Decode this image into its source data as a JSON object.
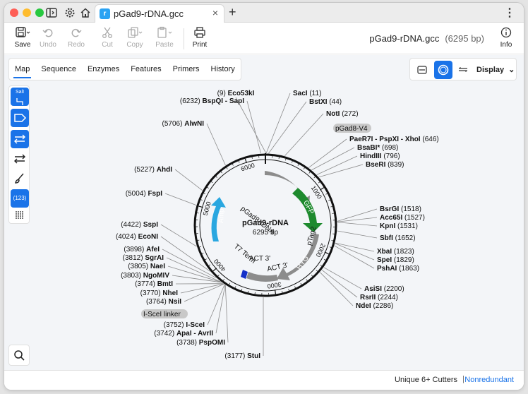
{
  "window": {
    "tab_title": "pGad9-rDNA.gcc",
    "tab_close": "×",
    "new_tab": "+",
    "menu": "⋮"
  },
  "toolbar": {
    "save": "Save",
    "undo": "Undo",
    "redo": "Redo",
    "cut": "Cut",
    "copy": "Copy",
    "paste": "Paste",
    "print": "Print",
    "info": "Info",
    "doc_name": "pGad9-rDNA.gcc",
    "doc_length": "(6295 bp)"
  },
  "view_tabs": [
    "Map",
    "Sequence",
    "Enzymes",
    "Features",
    "Primers",
    "History"
  ],
  "display": {
    "label": "Display"
  },
  "sidebar": {
    "sail_label": "SalI",
    "count_label": "(123)"
  },
  "map": {
    "name": "pGad9-rDNA",
    "length": "6295 bp",
    "ticks": [
      "1000",
      "2000",
      "3000",
      "4000",
      "5000",
      "6000"
    ],
    "features": {
      "pgad8_rdna": "pGad8-rDNA",
      "gfp": "GFP",
      "ptag2": "pTag2",
      "hyg": "HYG",
      "act3a": "ACT 3'",
      "act3b": "ACT 3'",
      "t7term": "T7 Term",
      "amp": "Amp"
    },
    "chips": {
      "pgad8_v4": "pGad8-V4",
      "isce_linker": "I-SceI linker"
    },
    "sites": [
      {
        "pos": "(9)",
        "name": "Eco53kI"
      },
      {
        "pos": "(11)",
        "name": "SacI",
        "pos_after": true
      },
      {
        "pos": "(44)",
        "name": "BstXI",
        "pos_after": true
      },
      {
        "pos": "(272)",
        "name": "NotI",
        "pos_after": true
      },
      {
        "pos": "(646)",
        "name": "PaeR7I - PspXI - XhoI",
        "pos_after": true
      },
      {
        "pos": "(698)",
        "name": "BsaBI*",
        "pos_after": true
      },
      {
        "pos": "(796)",
        "name": "HindIII",
        "pos_after": true
      },
      {
        "pos": "(839)",
        "name": "BseRI",
        "pos_after": true
      },
      {
        "pos": "(1518)",
        "name": "BsrGI",
        "pos_after": true
      },
      {
        "pos": "(1527)",
        "name": "Acc65I",
        "pos_after": true
      },
      {
        "pos": "(1531)",
        "name": "KpnI",
        "pos_after": true
      },
      {
        "pos": "(1652)",
        "name": "SbfI",
        "pos_after": true
      },
      {
        "pos": "(1823)",
        "name": "XbaI",
        "pos_after": true
      },
      {
        "pos": "(1829)",
        "name": "SpeI",
        "pos_after": true
      },
      {
        "pos": "(1863)",
        "name": "PshAI",
        "pos_after": true
      },
      {
        "pos": "(2200)",
        "name": "AsiSI",
        "pos_after": true
      },
      {
        "pos": "(2244)",
        "name": "RsrII",
        "pos_after": true
      },
      {
        "pos": "(2286)",
        "name": "NdeI",
        "pos_after": true
      },
      {
        "pos": "(3177)",
        "name": "StuI"
      },
      {
        "pos": "(3738)",
        "name": "PspOMI"
      },
      {
        "pos": "(3742)",
        "name": "ApaI - AvrII"
      },
      {
        "pos": "(3752)",
        "name": "I-SceI"
      },
      {
        "pos": "(3764)",
        "name": "NsiI"
      },
      {
        "pos": "(3770)",
        "name": "NheI"
      },
      {
        "pos": "(3774)",
        "name": "BmtI"
      },
      {
        "pos": "(3803)",
        "name": "NgoMIV"
      },
      {
        "pos": "(3805)",
        "name": "NaeI"
      },
      {
        "pos": "(3812)",
        "name": "SgrAI"
      },
      {
        "pos": "(3898)",
        "name": "AfeI"
      },
      {
        "pos": "(4024)",
        "name": "EcoNI"
      },
      {
        "pos": "(4422)",
        "name": "SspI"
      },
      {
        "pos": "(5004)",
        "name": "FspI"
      },
      {
        "pos": "(5227)",
        "name": "AhdI"
      },
      {
        "pos": "(5706)",
        "name": "AlwNI"
      },
      {
        "pos": "(6232)",
        "name": "BspQI - SapI"
      }
    ]
  },
  "status": {
    "filter": "Unique 6+ Cutters",
    "separator": "|",
    "mode": "Nonredundant"
  },
  "colors": {
    "accent": "#1a73e8",
    "gfp": "#1e8a2e",
    "amp": "#29a7e0",
    "t7": "#1430c8",
    "feature_grey": "#8c8c8c"
  }
}
